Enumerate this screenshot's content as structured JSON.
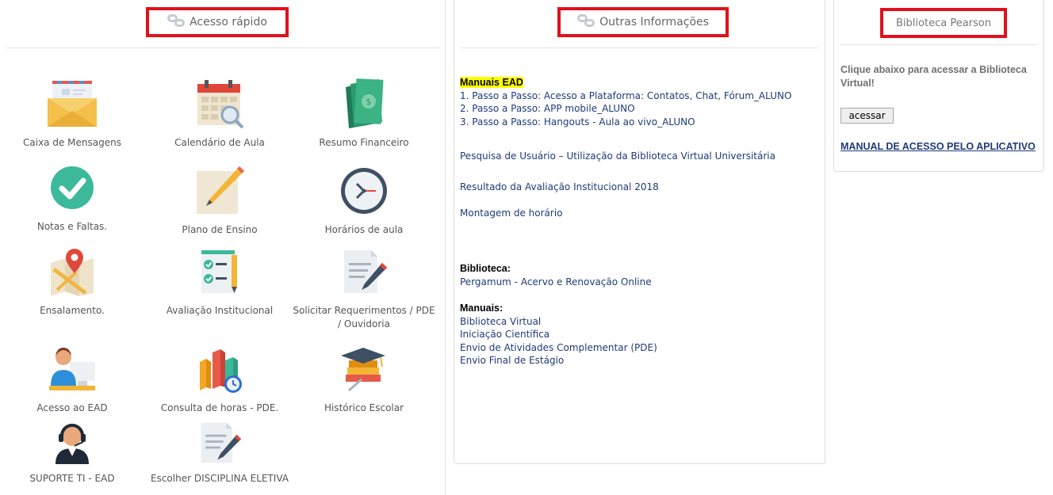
{
  "acesso": {
    "title": "Acesso rápido",
    "tiles": [
      {
        "label": "Caixa de Mensagens",
        "icon": "mail-envelope-icon"
      },
      {
        "label": "Calendário de Aula",
        "icon": "calendar-search-icon"
      },
      {
        "label": "Resumo Financeiro",
        "icon": "money-bills-icon"
      },
      {
        "label": "Notas e Faltas.",
        "icon": "check-circle-icon"
      },
      {
        "label": "Plano de Ensino",
        "icon": "pencil-paper-icon"
      },
      {
        "label": "Horários de aula",
        "icon": "clock-icon"
      },
      {
        "label": "Ensalamento.",
        "icon": "map-pin-icon"
      },
      {
        "label": "Avaliação Institucional",
        "icon": "checklist-icon"
      },
      {
        "label": "Solicitar Requerimentos / PDE / Ouvidoria",
        "icon": "document-edit-icon"
      },
      {
        "label": "Acesso ao EAD",
        "icon": "user-computer-icon"
      },
      {
        "label": "Consulta de horas - PDE.",
        "icon": "bar-chart-clock-icon"
      },
      {
        "label": "Histórico Escolar",
        "icon": "books-graduation-icon"
      },
      {
        "label": "SUPORTE TI - EAD",
        "icon": "support-headset-icon"
      },
      {
        "label": "Escolher DISCIPLINA ELETIVA",
        "icon": "document-edit-icon"
      }
    ]
  },
  "outras": {
    "title": "Outras Informações",
    "manuais_ead": {
      "heading": "Manuais EAD",
      "items": [
        "1. Passo a Passo: Acesso a Plataforma: Contatos, Chat, Fórum_ALUNO",
        "2. Passo a Passo: APP mobile_ALUNO",
        "3. Passo a Passo: Hangouts - Aula ao vivo_ALUNO"
      ]
    },
    "pesquisa": "Pesquisa de Usuário – Utilização da Biblioteca Virtual Universitária",
    "resultado": "Resultado da Avaliação Institucional 2018",
    "montagem": "Montagem de horário",
    "biblioteca": {
      "heading": "Biblioteca:",
      "items": [
        "Pergamum - Acervo e Renovação Online"
      ]
    },
    "manuais": {
      "heading": "Manuais:",
      "items": [
        "Biblioteca Virtual",
        "Iniciação Científica",
        "Envio de Atividades Complementar (PDE)",
        "Envio Final de Estágio"
      ]
    }
  },
  "pearson": {
    "title": "Biblioteca Pearson",
    "description": "Clique abaixo para acessar a Biblioteca Virtual!",
    "button": "acessar",
    "manual_link": "MANUAL DE ACESSO PELO APLICATIVO"
  },
  "colors": {
    "highlight_box": "#e0111c",
    "link": "#1f3a78",
    "ead_highlight": "#ffff00"
  }
}
